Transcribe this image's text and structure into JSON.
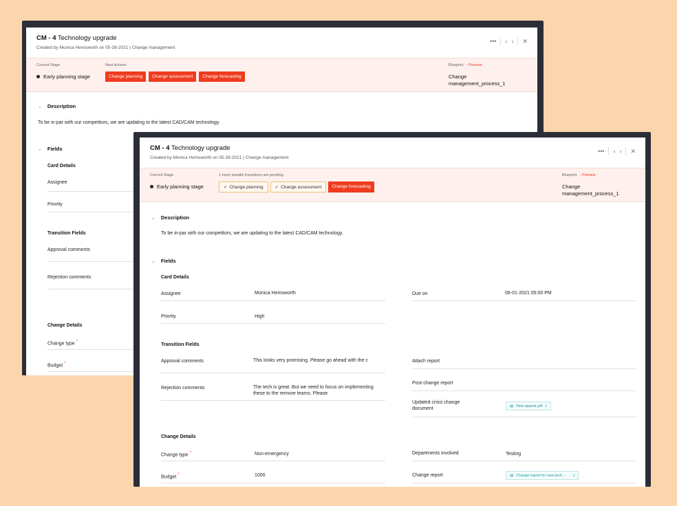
{
  "card": {
    "key": "CM - 4",
    "name": "Technology upgrade",
    "created_by_prefix": "Created by",
    "creator": "Monica Hemsworth",
    "on_word": "on",
    "created_date": "05-28-2021",
    "category": "| Change management"
  },
  "controls": {
    "more": "•••",
    "prev": "‹",
    "next": "›",
    "close": "✕"
  },
  "stage": {
    "label": "Current Stage",
    "value": "Early planning stage",
    "next_actions_label": "Next Actions",
    "pending_note": "1 more parallel transitions are pending.",
    "actions": [
      "Change planning",
      "Change assessment",
      "Change forecasting"
    ],
    "check_glyph": "✓",
    "blueprint_label": "Blueprint",
    "preview_label": "- Preview",
    "blueprint_value": "Change management_process_1"
  },
  "description": {
    "heading": "Description",
    "text": "To be in-par with our competitors, we are updating to the latest CAD/CAM technology."
  },
  "fields": {
    "heading": "Fields",
    "card_details": "Card Details",
    "assignee_label": "Assignee",
    "assignee_value": "Monica Hemsworth",
    "due_label": "Due on",
    "due_value": "06-01-2021 05:00 PM",
    "priority_label": "Priority",
    "priority_value": "High",
    "transition_fields": "Transition Fields",
    "approval_label": "Approval comments",
    "approval_value": "This looks very promising. Please go ahead with the c",
    "attach_report_label": "Attach report",
    "rejection_label": "Rejection comments",
    "rejection_value": "The tech is great. But we need to focus on implementing these to the remove teams. Please",
    "post_change_label": "Post-change report",
    "crisis_label": "Updated crisis change document",
    "crisis_file": "New appeal.pdf",
    "change_details": "Change Details",
    "change_type_label": "Change type",
    "change_type_value": "Non-emergency",
    "departments_label": "Departments involved",
    "departments_value": "Testing",
    "budget_label": "Budget",
    "budget_value": "1000",
    "change_report_label": "Change report",
    "change_report_file": "Change report for new tech....",
    "required_mark": "*"
  },
  "colors": {
    "accent": "#ef3b1e",
    "background": "#fbd6ad",
    "frame": "#2b2e38",
    "stage_band": "#fef0ec"
  }
}
